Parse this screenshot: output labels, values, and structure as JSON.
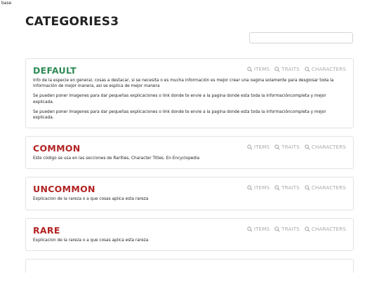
{
  "base_label": "base",
  "page_title": "CATEGORIES3",
  "search": {
    "value": "",
    "placeholder": ""
  },
  "link_labels": {
    "items": "ITEMS",
    "traits": "TRAITS",
    "characters": "CHARACTERS"
  },
  "colors": {
    "default_title": "#2e8b57",
    "rarity_title": "#b22222",
    "link": "#a9a9a9",
    "border": "#e3e3e3"
  },
  "icons": {
    "link_icon": "search-icon"
  },
  "categories": [
    {
      "title": "DEFAULT",
      "color": "#2e8b57",
      "paragraphs": [
        "Info de la especie en general, cosas a destacar, si se necesita o es mucha información es mejor crear una oagina solamente para desglosar toda la información de mejor manera, asi se esplica de mejor manera",
        "Se pueden poner imagenes para dar pequeñas explicaciones o link donde te envie a la pagina donde esta toda la informacióncompleta y mejor explicada.",
        "Se pueden poner imagenes para dar pequeñas explicaciones o link donde te envie a la pagina donde esta toda la informacióncompleta y mejor explicada."
      ]
    },
    {
      "title": "COMMON",
      "color": "#b22222",
      "paragraphs": [
        "Este código se usa en las secciones de Rarities, Character Titles. En Encyclopedia"
      ]
    },
    {
      "title": "UNCOMMON",
      "color": "#b22222",
      "paragraphs": [
        "Explicacion de la rareza o a que cosas aplica esta rareza"
      ]
    },
    {
      "title": "RARE",
      "color": "#b22222",
      "paragraphs": [
        "Explicacion de la rareza o a que cosas aplica esta rareza"
      ]
    }
  ]
}
